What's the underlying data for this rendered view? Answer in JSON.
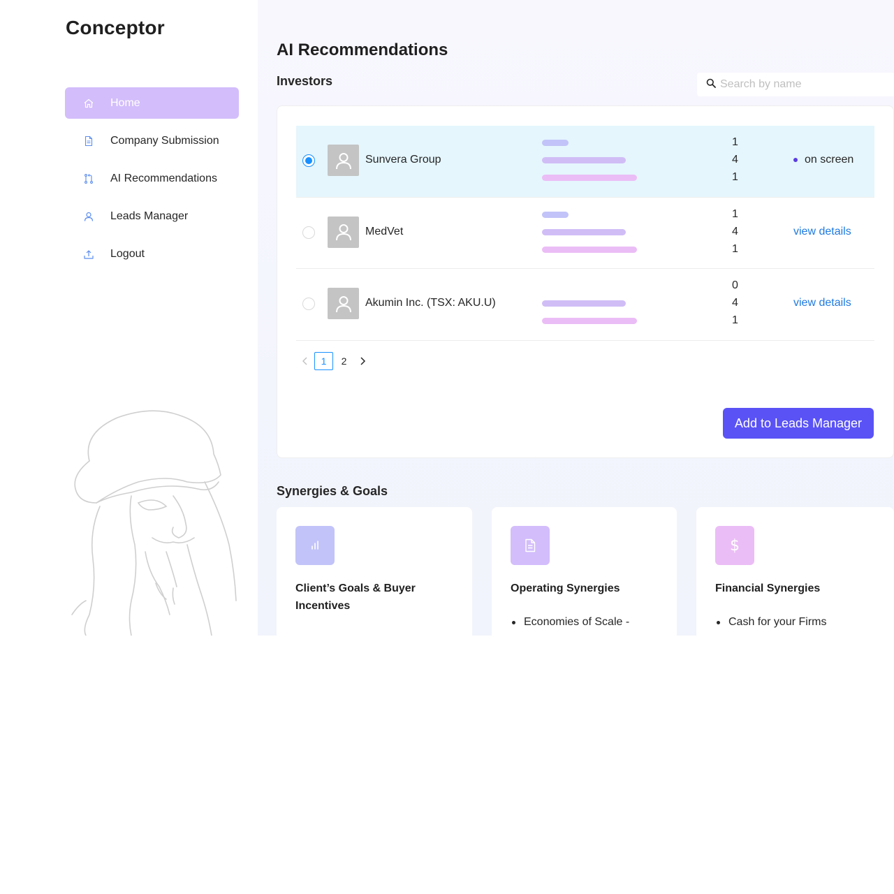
{
  "sidebar": {
    "brand": "Conceptor",
    "items": [
      {
        "label": "Home",
        "icon": "home-icon",
        "active": true
      },
      {
        "label": "Company Submission",
        "icon": "file-icon"
      },
      {
        "label": "AI Recommendations",
        "icon": "pull-request-icon"
      },
      {
        "label": "Leads Manager",
        "icon": "user-icon"
      },
      {
        "label": "Logout",
        "icon": "upload-icon"
      }
    ]
  },
  "main": {
    "title": "AI Recommendations",
    "investors_title": "Investors",
    "search": {
      "placeholder": "Search by name"
    },
    "rows": [
      {
        "name": "Sunvera Group",
        "scores": [
          "1",
          "4",
          "1"
        ],
        "status": "on screen",
        "selected": true
      },
      {
        "name": "MedVet",
        "scores": [
          "1",
          "4",
          "1"
        ],
        "action": "view details",
        "selected": false
      },
      {
        "name": "Akumin Inc. (TSX: AKU.U)",
        "scores": [
          "0",
          "4",
          "1"
        ],
        "action": "view details",
        "selected": false
      }
    ],
    "pagination": {
      "pages": [
        "1",
        "2"
      ],
      "current": "1"
    },
    "add_button": "Add to Leads Manager",
    "synergies_title": "Synergies & Goals",
    "synergies": [
      {
        "title_line1": "Client’s Goals & Buyer",
        "title_line2": "Incentives",
        "icon": "bar-chart-icon",
        "color": "#c2c3f8"
      },
      {
        "title_line1": "Operating Synergies",
        "item": "Economies of Scale -",
        "icon": "document-icon",
        "color": "#d3bdfb"
      },
      {
        "title_line1": "Financial Synergies",
        "item": "Cash for your Firms",
        "icon": "dollar-icon",
        "color": "#ebbdf6"
      }
    ]
  },
  "colors": {
    "accent": "#5a52f5",
    "nav_active": "#d3bdfb",
    "selected_row": "#e5f6fd",
    "link": "#1f7ae0"
  }
}
